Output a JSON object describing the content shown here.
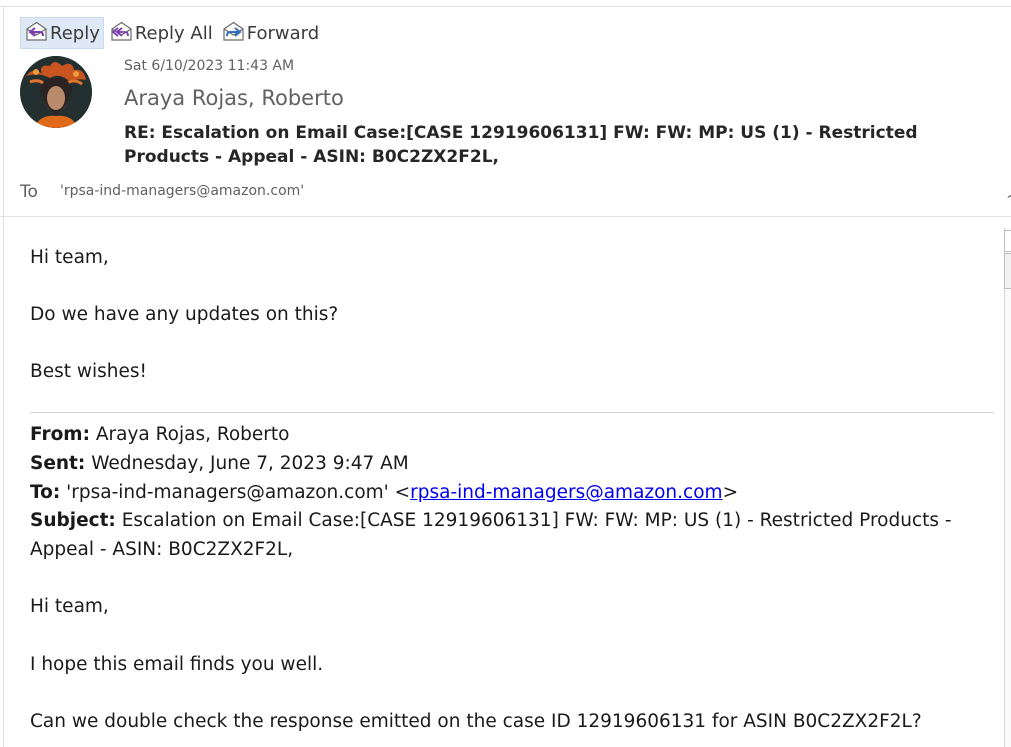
{
  "toolbar": {
    "reply_label": "Reply",
    "reply_all_label": "Reply All",
    "forward_label": "Forward"
  },
  "header": {
    "datetime": "Sat 6/10/2023 11:43 AM",
    "sender": "Araya Rojas, Roberto",
    "subject": "RE: Escalation on Email Case:[CASE 12919606131] FW: FW: MP: US (1) - Restricted Products - Appeal - ASIN: B0C2ZX2F2L,",
    "to_label": "To",
    "to_address": "'rpsa-ind-managers@amazon.com'"
  },
  "body": {
    "greeting": "Hi team,",
    "question": "Do we have any updates on this?",
    "signoff": "Best wishes!"
  },
  "quoted": {
    "from_label": "From:",
    "from_value": "Araya Rojas, Roberto",
    "sent_label": "Sent:",
    "sent_value": "Wednesday, June 7, 2023 9:47 AM",
    "to_label": "To:",
    "to_value_prefix": "'rpsa-ind-managers@amazon.com' <",
    "to_link": "rpsa-ind-managers@amazon.com",
    "to_value_suffix": ">",
    "subject_label": "Subject:",
    "subject_value": "Escalation on Email Case:[CASE 12919606131] FW: FW: MP: US (1) - Restricted Products - Appeal - ASIN: B0C2ZX2F2L,",
    "greeting": "Hi team,",
    "line1": "I hope this email finds you well.",
    "line2": "Can we double check the response emitted on the case ID 12919606131 for ASIN B0C2ZX2F2L?"
  },
  "icons": {
    "reply": "reply-envelope-icon",
    "reply_all": "reply-all-envelope-icon",
    "forward": "forward-envelope-icon",
    "avatar": "sender-avatar"
  },
  "colors": {
    "accent_link": "#0000ee",
    "reply_arrow": "#7a3bb0",
    "forward_arrow": "#2f6fbf",
    "active_button_bg": "#dfe9f5"
  }
}
